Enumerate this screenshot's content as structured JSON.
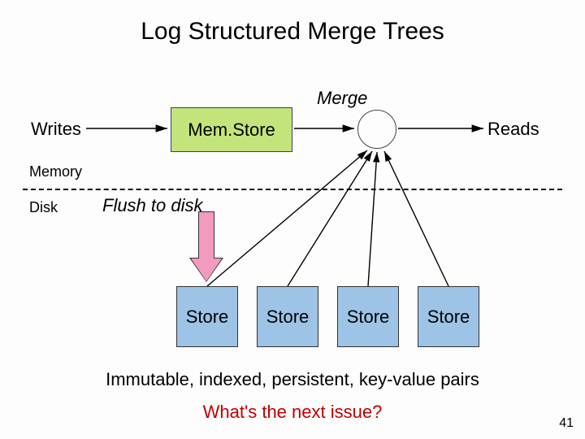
{
  "title": "Log Structured Merge Trees",
  "labels": {
    "merge": "Merge",
    "writes": "Writes",
    "reads": "Reads",
    "memstore": "Mem.Store",
    "memory": "Memory",
    "disk": "Disk",
    "flush": "Flush to disk"
  },
  "stores": [
    "Store",
    "Store",
    "Store",
    "Store"
  ],
  "caption": "Immutable, indexed, persistent, key-value pairs",
  "question": "What's the next issue?",
  "page_number": "41"
}
